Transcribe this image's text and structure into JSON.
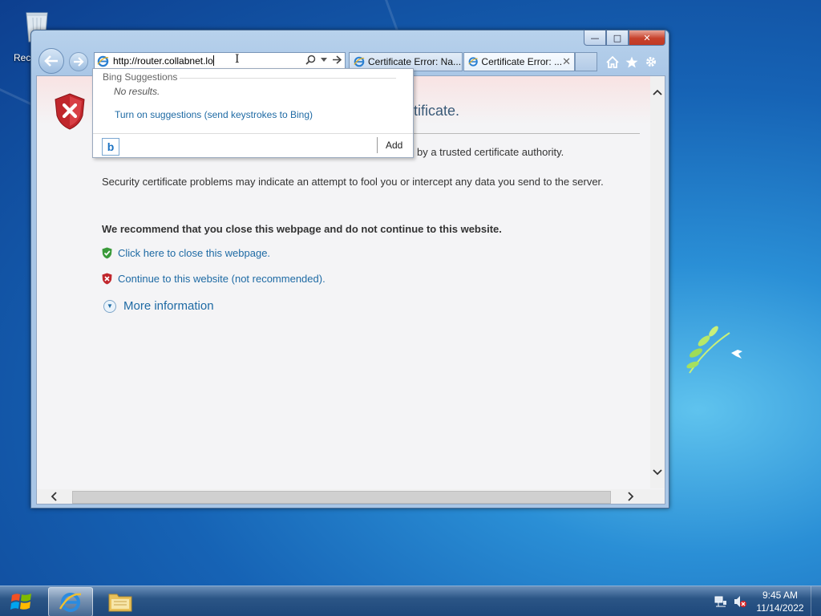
{
  "desktop": {
    "recycle_bin_label": "Recycle Bin"
  },
  "browser": {
    "address_url": "http://router.collabnet.lo",
    "tabs": [
      {
        "title": "Certificate Error: Na..."
      },
      {
        "title": "Certificate Error: ..."
      }
    ],
    "tab_close_symbol": "✕",
    "window_controls": {
      "minimize": "—",
      "maximize": "□",
      "close": "✕"
    }
  },
  "suggestions": {
    "header": "Bing Suggestions",
    "no_results": "No results.",
    "turn_on": "Turn on suggestions (send keystrokes to Bing)",
    "provider_icon": "b",
    "add_label": "Add"
  },
  "page": {
    "title_partial": "tificate.",
    "desc1_partial": "by a trusted certificate authority.",
    "desc2": "Security certificate problems may indicate an attempt to fool you or intercept any data you send to the server.",
    "recommend": "We recommend that you close this webpage and do not continue to this website.",
    "close_link": "Click here to close this webpage.",
    "continue_link": "Continue to this website (not recommended).",
    "more_info": "More information"
  },
  "taskbar": {
    "time": "9:45 AM",
    "date": "11/14/2022"
  },
  "colors": {
    "link": "#1e6aa4",
    "error_shield": "#c0262c",
    "ok_shield": "#3a9a3a"
  }
}
